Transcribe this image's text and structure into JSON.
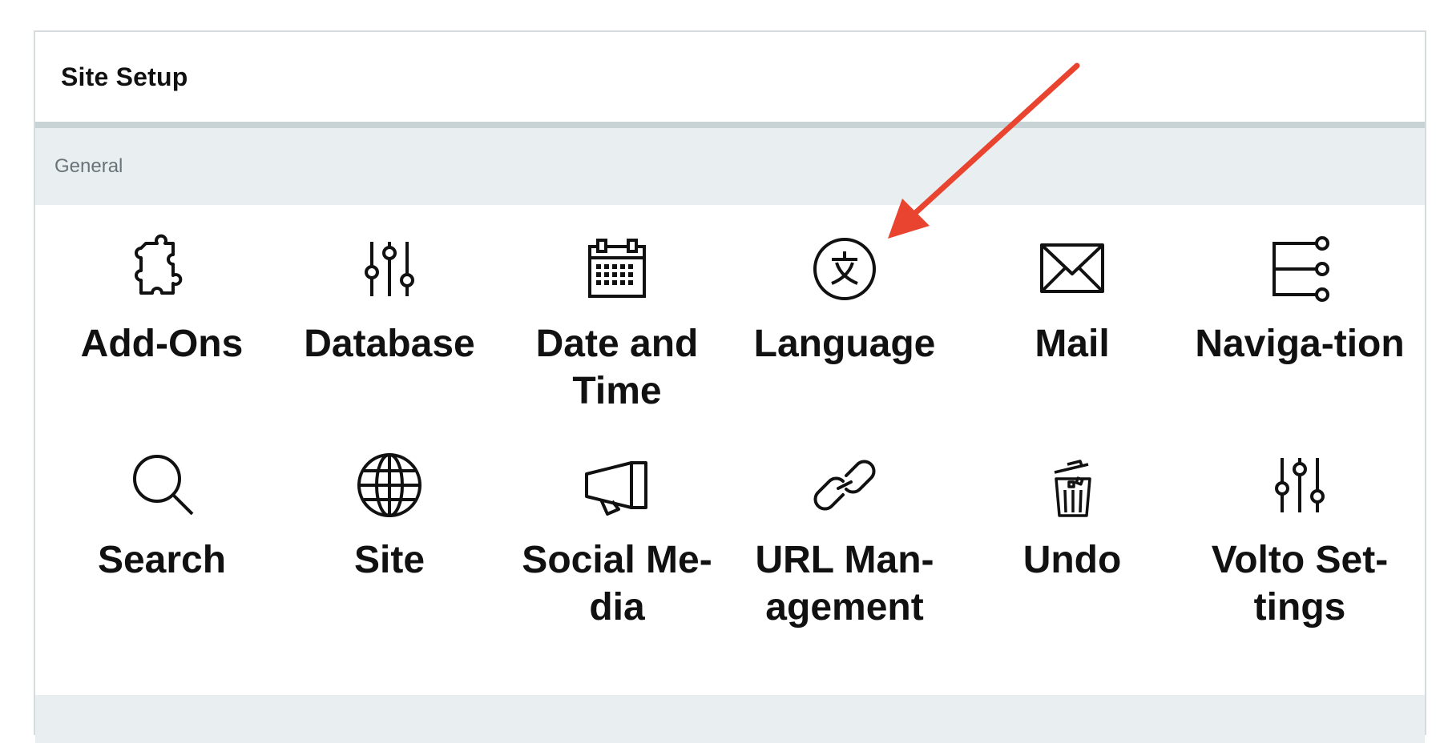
{
  "header": {
    "title": "Site Setup"
  },
  "section": {
    "label": "General"
  },
  "tiles": [
    {
      "label": "Add-Ons",
      "icon": "puzzle-icon"
    },
    {
      "label": "Database",
      "icon": "sliders-icon"
    },
    {
      "label": "Date and Time",
      "icon": "calendar-icon"
    },
    {
      "label": "Language",
      "icon": "language-icon"
    },
    {
      "label": "Mail",
      "icon": "mail-icon"
    },
    {
      "label": "Naviga-tion",
      "icon": "navigation-icon"
    },
    {
      "label": "Search",
      "icon": "search-icon"
    },
    {
      "label": "Site",
      "icon": "globe-icon"
    },
    {
      "label": "Social Me-dia",
      "icon": "megaphone-icon"
    },
    {
      "label": "URL Man-agement",
      "icon": "link-icon"
    },
    {
      "label": "Undo",
      "icon": "trash-icon"
    },
    {
      "label": "Volto Set-tings",
      "icon": "sliders-icon"
    }
  ],
  "annotation": {
    "arrow_color": "#e8442f"
  }
}
